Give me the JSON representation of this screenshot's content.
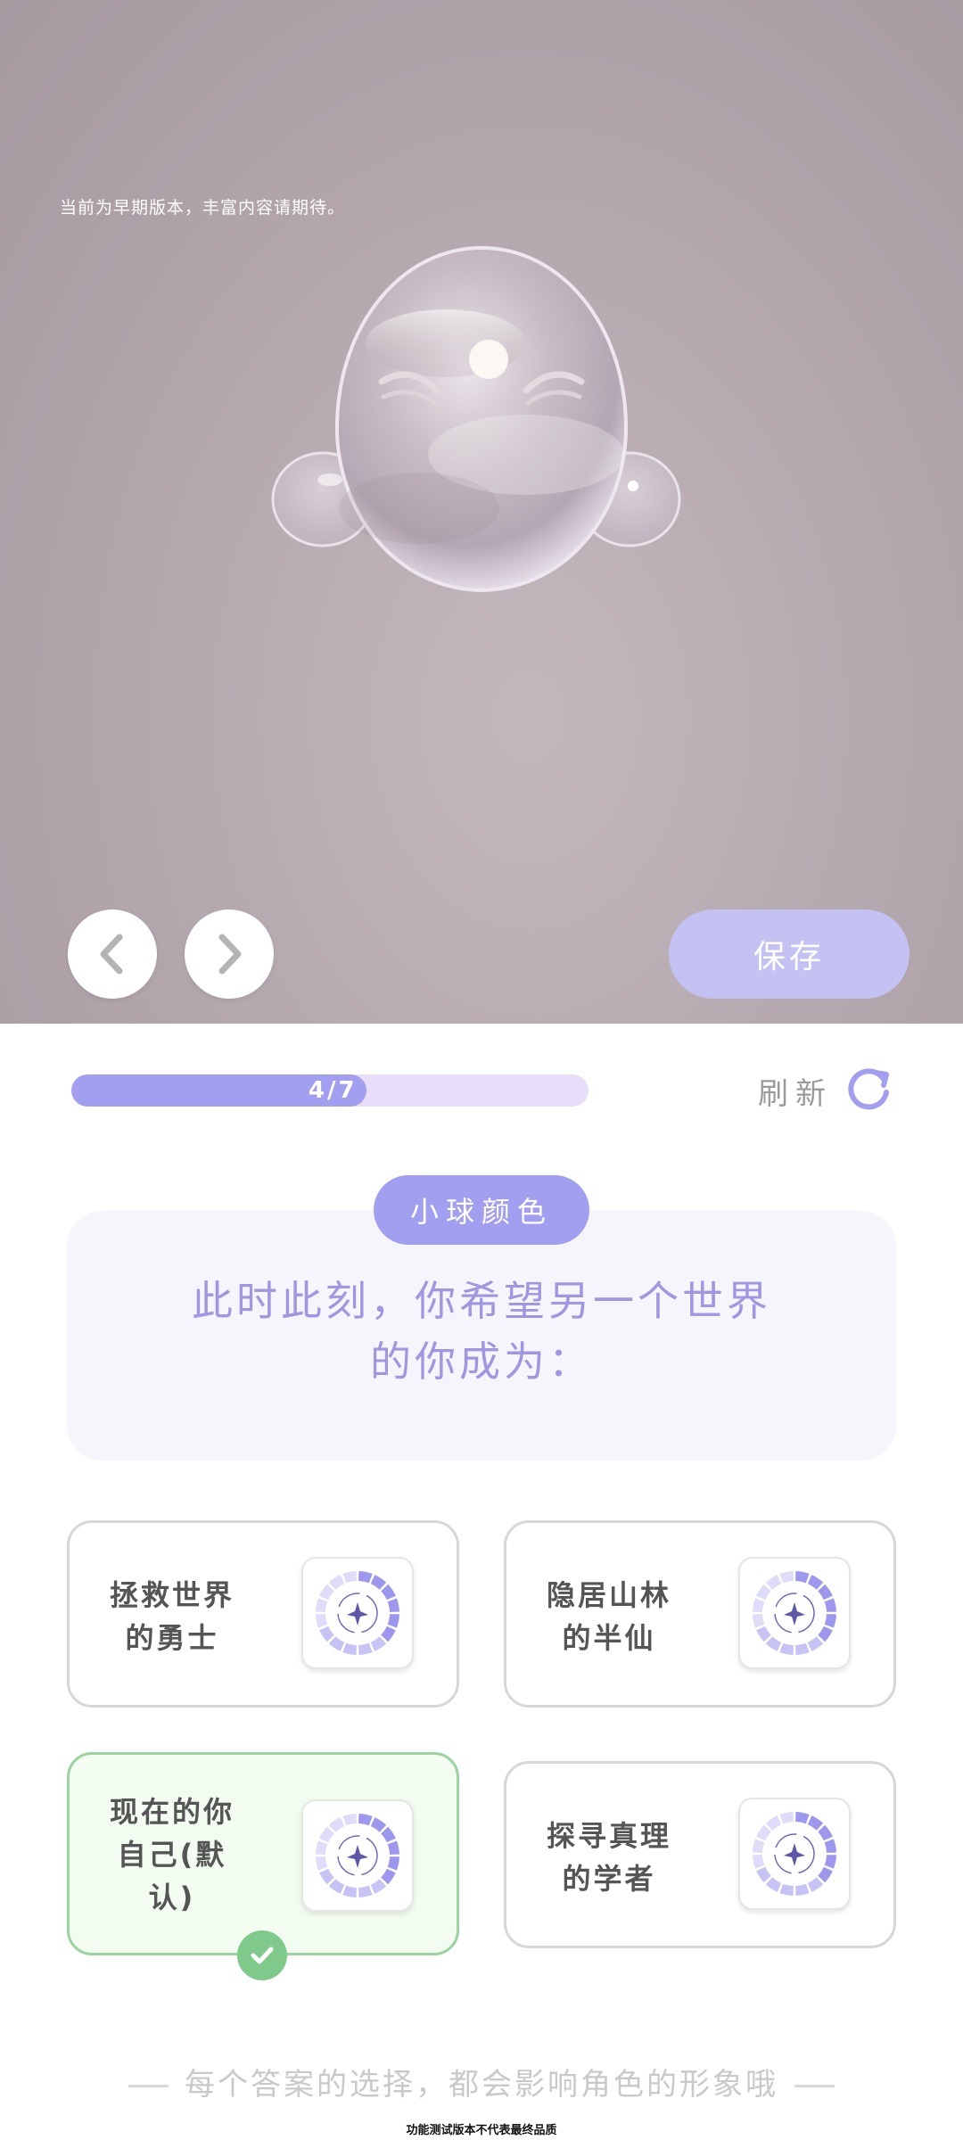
{
  "preview": {
    "notice": "当前为早期版本，丰富内容请期待。",
    "save_label": "保存",
    "prev_icon": "chevron-left-icon",
    "next_icon": "chevron-right-icon"
  },
  "progress": {
    "text": "4/7",
    "current": 4,
    "total": 7,
    "fill_fraction": 0.57
  },
  "refresh": {
    "label": "刷新",
    "icon": "refresh-icon"
  },
  "question": {
    "tag": "小球颜色",
    "line1": "此时此刻，你希望另一个世界",
    "line2": "的你成为："
  },
  "options": [
    {
      "line1": "拯救世界",
      "line2": "的勇士",
      "selected": false,
      "icon": "compass-icon"
    },
    {
      "line1": "隐居山林",
      "line2": "的半仙",
      "selected": false,
      "icon": "compass-icon"
    },
    {
      "line1": "现在的你",
      "line2": "自己(默",
      "line3": "认)",
      "selected": true,
      "icon": "compass-icon"
    },
    {
      "line1": "探寻真理",
      "line2": "的学者",
      "selected": false,
      "icon": "compass-icon"
    }
  ],
  "hint": "每个答案的选择，都会影响角色的形象哦",
  "footer": "功能测试版本不代表最终品质",
  "colors": {
    "accent": "#a29ef0",
    "accent_light": "#e9defa",
    "save_button": "#c3c2f3",
    "selected_border": "#9bd4a0",
    "check_green": "#7fca8b",
    "question_text": "#9f97e2"
  }
}
